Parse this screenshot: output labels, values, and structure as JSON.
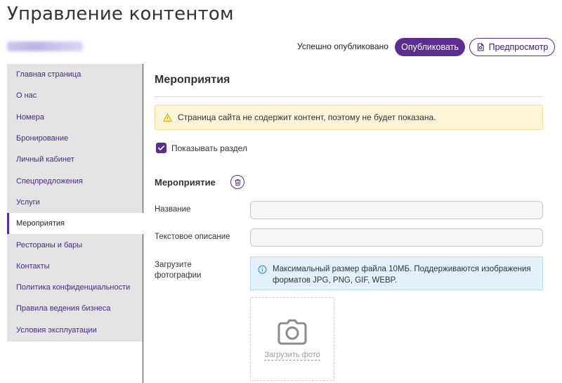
{
  "header": {
    "title": "Управление контентом",
    "status": "Успешно опубликовано",
    "publish_label": "Опубликовать",
    "preview_label": "Предпросмотр"
  },
  "sidebar": {
    "items": [
      {
        "label": "Главная страница"
      },
      {
        "label": "О нас"
      },
      {
        "label": "Номера"
      },
      {
        "label": "Бронирование"
      },
      {
        "label": "Личный кабинет"
      },
      {
        "label": "Спецпредложения"
      },
      {
        "label": "Услуги"
      },
      {
        "label": "Мероприятия",
        "active": true
      },
      {
        "label": "Рестораны и бары"
      },
      {
        "label": "Контакты"
      },
      {
        "label": "Политика конфиденциальности"
      },
      {
        "label": "Правила ведения бизнеса"
      },
      {
        "label": "Условия эксплуатации"
      }
    ]
  },
  "main": {
    "section_title": "Мероприятия",
    "warning_text": "Страница сайта не содержит контент, поэтому не будет показана.",
    "show_section_label": "Показывать раздел",
    "show_section_checked": true,
    "event_heading": "Мероприятие",
    "fields": {
      "name_label": "Название",
      "name_value": "",
      "description_label": "Текстовое описание",
      "description_value": "",
      "upload_label_line1": "Загрузите",
      "upload_label_line2": "фотографии"
    },
    "info_text_line1": "Максимальный размер файла 10МБ. Поддерживаются изображения",
    "info_text_line2": "форматов JPG, PNG, GIF, WEBP.",
    "upload_button_label": "Загрузить фото"
  },
  "colors": {
    "accent": "#5a2d91",
    "sidebar_bg": "#e3e3e3",
    "warning_bg": "#fdf5d9",
    "info_bg": "#e4f1fb"
  },
  "icons": {
    "warning": "warning-triangle-icon",
    "check": "check-icon",
    "delete": "trash-icon",
    "info": "info-circle-icon",
    "camera": "camera-icon",
    "preview": "document-preview-icon"
  }
}
